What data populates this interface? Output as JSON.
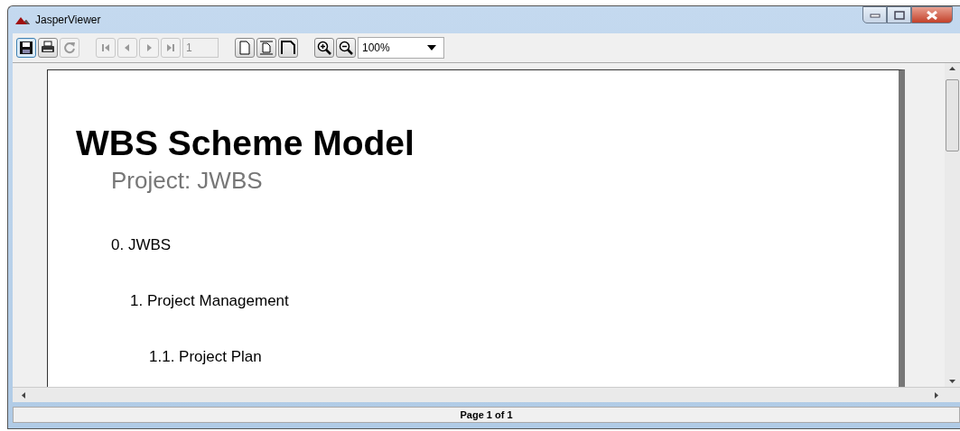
{
  "window": {
    "title": "JasperViewer"
  },
  "toolbar": [
    {
      "kind": "save",
      "disabled": false
    },
    {
      "kind": "print",
      "disabled": false
    },
    {
      "kind": "reload",
      "disabled": true
    },
    {
      "kind": "first",
      "disabled": true
    },
    {
      "kind": "previous",
      "disabled": true
    },
    {
      "kind": "next",
      "disabled": true
    },
    {
      "kind": "last",
      "disabled": true
    },
    {
      "kind": "page-field",
      "value": "1",
      "disabled": true
    },
    {
      "kind": "actual-size",
      "disabled": false
    },
    {
      "kind": "fit-page",
      "disabled": false
    },
    {
      "kind": "fit-width",
      "disabled": false
    },
    {
      "kind": "zoom-in",
      "disabled": false
    },
    {
      "kind": "zoom-out",
      "disabled": false
    },
    {
      "kind": "zoom-select",
      "value": "100%",
      "disabled": false
    }
  ],
  "report": {
    "title": "WBS Scheme Model",
    "subtitle": "Project: JWBS",
    "items": [
      {
        "label": "0. JWBS",
        "children": [
          {
            "label": "1. Project Management",
            "children": [
              {
                "label": "1.1. Project Plan"
              }
            ]
          }
        ]
      }
    ]
  },
  "status_bar": "Page 1 of 1"
}
